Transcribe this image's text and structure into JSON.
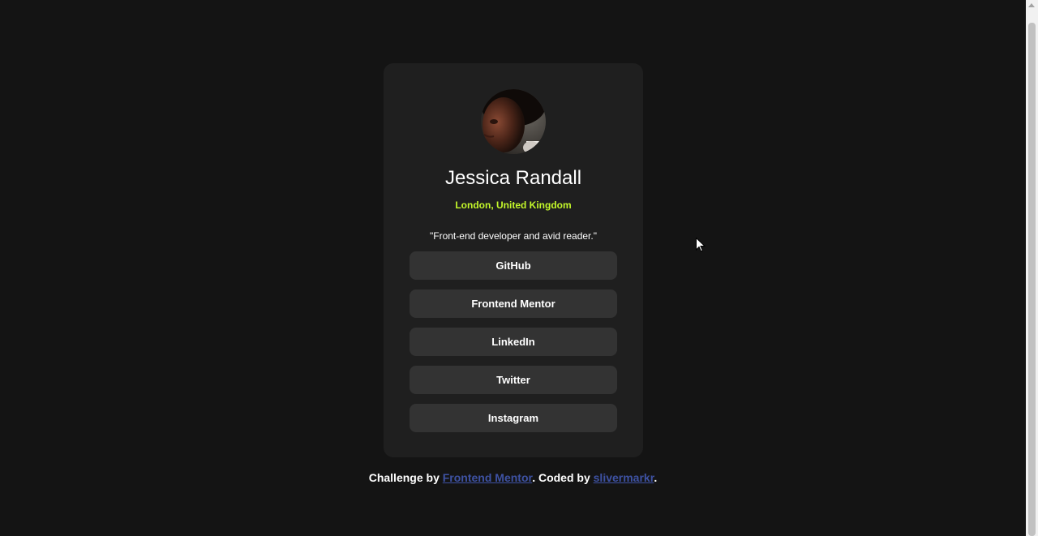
{
  "profile": {
    "name": "Jessica Randall",
    "location": "London, United Kingdom",
    "bio": "\"Front-end developer and avid reader.\""
  },
  "links": [
    {
      "label": "GitHub"
    },
    {
      "label": "Frontend Mentor"
    },
    {
      "label": "LinkedIn"
    },
    {
      "label": "Twitter"
    },
    {
      "label": "Instagram"
    }
  ],
  "footer": {
    "prefix": "Challenge by ",
    "challenge_link": "Frontend Mentor",
    "middle": ". Coded by ",
    "author_link": "slivermarkr",
    "suffix": "."
  },
  "colors": {
    "background": "#141414",
    "card": "#1f1f1f",
    "button": "#333333",
    "accent": "#c4f82a",
    "link": "#3e52a3"
  },
  "icons": {
    "cursor": "arrow-cursor-icon"
  }
}
